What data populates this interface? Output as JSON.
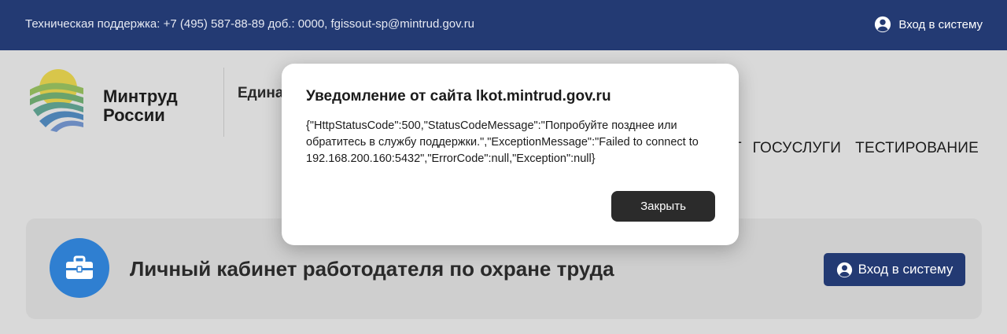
{
  "topbar": {
    "support_text": "Техническая поддержка: +7 (495) 587-88-89 доб.: 0000, fgissout-sp@mintrud.gov.ru",
    "login_label": "Вход в систему",
    "login_icon": "user-circle-icon"
  },
  "header": {
    "logo_text": "Минтруд России",
    "logo_icon": "mintrud-emblem-icon",
    "system_name_partial": "Единая инфо",
    "nav": {
      "partial_item": "Т",
      "items": [
        "ГОСУСЛУГИ",
        "ТЕСТИРОВАНИЕ"
      ]
    }
  },
  "card": {
    "icon": "briefcase-icon",
    "title": "Личный кабинет работодателя по охране труда",
    "login_label": "Вход в систему"
  },
  "dialog": {
    "title": "Уведомление от сайта lkot.mintrud.gov.ru",
    "message": "{\"HttpStatusCode\":500,\"StatusCodeMessage\":\"Попробуйте позднее или обратитесь в службу поддержки.\",\"ExceptionMessage\":\"Failed to connect to 192.168.200.160:5432\",\"ErrorCode\":null,\"Exception\":null}",
    "close_label": "Закрыть"
  },
  "colors": {
    "topbar": "#233a73",
    "overlay_background": "#d9d9d9",
    "card_icon": "#2f7fd1",
    "close_button": "#2b2b2b"
  }
}
